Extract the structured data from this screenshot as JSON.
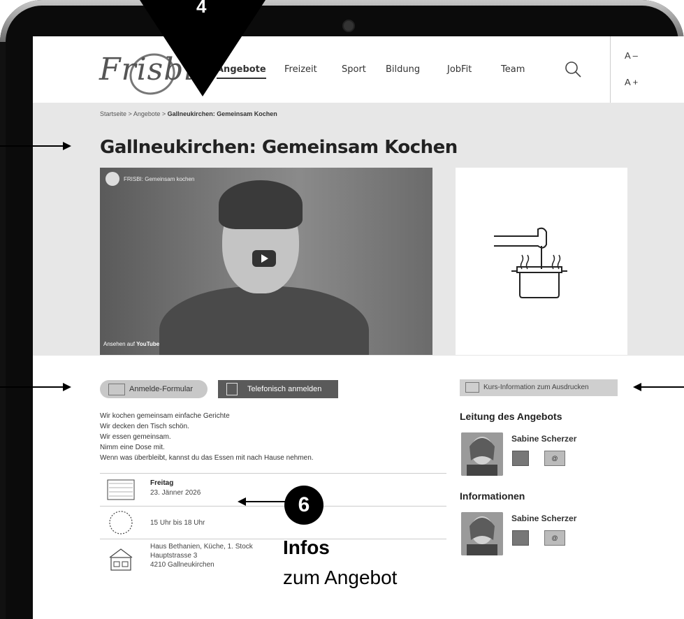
{
  "overlay": {
    "step_top": "4",
    "step_six": "6",
    "callout_title": "Infos",
    "callout_sub": "zum Angebot"
  },
  "header": {
    "logo": "Frisbi",
    "nav": [
      "Angebote",
      "Freizeit",
      "Sport",
      "Bildung",
      "JobFit",
      "Team"
    ],
    "active_nav": "Angebote",
    "font_smaller": "A –",
    "font_larger": "A +"
  },
  "breadcrumb": {
    "items": [
      "Startseite",
      "Angebote",
      "Gallneukirchen: Gemeinsam Kochen"
    ],
    "separator": ">"
  },
  "page": {
    "title": "Gallneukirchen: Gemeinsam Kochen"
  },
  "video": {
    "title": "FRISBI: Gemeinsam kochen",
    "watch_on": "Ansehen auf",
    "brand": "YouTube"
  },
  "actions": {
    "form_button": "Anmelde-Formular",
    "phone_button": "Telefonisch anmelden",
    "print_button": "Kurs-Information zum Ausdrucken"
  },
  "description": [
    "Wir kochen gemeinsam einfache Gerichte",
    "Wir decken den Tisch schön.",
    "Wir essen gemeinsam.",
    "Nimm eine Dose mit.",
    "Wenn was überbleibt, kannst du das Essen mit nach Hause nehmen."
  ],
  "details": {
    "day": "Freitag",
    "date": "23. Jänner 2026",
    "time": "15 Uhr bis 18 Uhr",
    "place_line1": "Haus Bethanien, Küche, 1. Stock",
    "place_line2": "Hauptstrasse 3",
    "place_line3": "4210 Gallneukirchen"
  },
  "sidebar": {
    "leitung_heading": "Leitung des Angebots",
    "leitung_name": "Sabine Scherzer",
    "info_heading": "Informationen",
    "info_name": "Sabine Scherzer"
  }
}
